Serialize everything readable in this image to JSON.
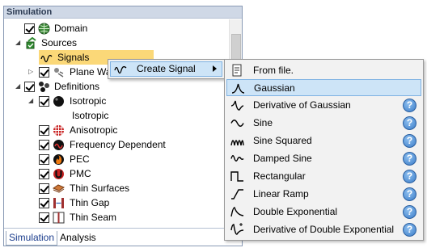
{
  "panel": {
    "title": "Simulation",
    "tabs": [
      {
        "label": "Simulation"
      },
      {
        "label": "Analysis"
      }
    ]
  },
  "tree": {
    "domain": "Domain",
    "sources": "Sources",
    "signals": "Signals",
    "plane_wave": "Plane Wa",
    "definitions": "Definitions",
    "isotropic": "Isotropic",
    "isotropic_child": "Isotropic",
    "anisotropic": "Anisotropic",
    "frequency_dependent": "Frequency Dependent",
    "pec": "PEC",
    "pmc": "PMC",
    "thin_surfaces": "Thin Surfaces",
    "thin_gap": "Thin Gap",
    "thin_seam": "Thin Seam"
  },
  "context_menu": {
    "create_signal": "Create Signal"
  },
  "submenu": {
    "items": [
      {
        "label": "From file."
      },
      {
        "label": "Gaussian"
      },
      {
        "label": "Derivative of Gaussian"
      },
      {
        "label": "Sine"
      },
      {
        "label": "Sine Squared"
      },
      {
        "label": "Damped Sine"
      },
      {
        "label": "Rectangular"
      },
      {
        "label": "Linear Ramp"
      },
      {
        "label": "Double Exponential"
      },
      {
        "label": "Derivative of Double Exponential"
      }
    ],
    "help_glyph": "?"
  },
  "colors": {
    "highlight": "#cde4f7",
    "highlight_border": "#7fb2e3",
    "signals_selected": "#fbd878",
    "panel_header": "#cfd8e6"
  }
}
